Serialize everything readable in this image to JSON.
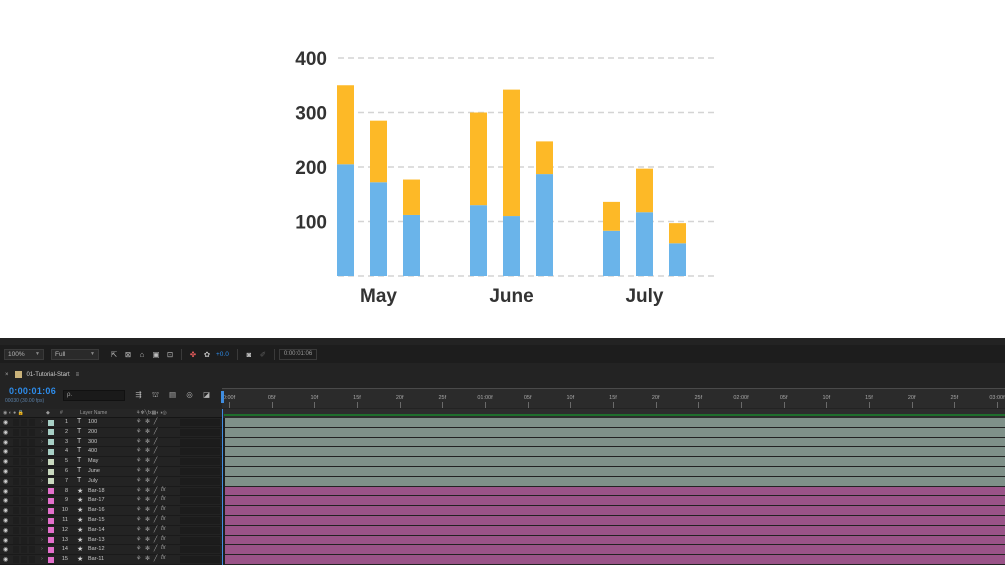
{
  "chart_data": {
    "type": "bar",
    "stacked": true,
    "groups": [
      "May",
      "June",
      "July"
    ],
    "bars": [
      {
        "group": "May",
        "bottom": 205,
        "top": 145
      },
      {
        "group": "May",
        "bottom": 172,
        "top": 113
      },
      {
        "group": "May",
        "bottom": 112,
        "top": 65
      },
      {
        "group": "June",
        "bottom": 130,
        "top": 170
      },
      {
        "group": "June",
        "bottom": 110,
        "top": 232
      },
      {
        "group": "June",
        "bottom": 187,
        "top": 60
      },
      {
        "group": "July",
        "bottom": 83,
        "top": 53
      },
      {
        "group": "July",
        "bottom": 117,
        "top": 80
      },
      {
        "group": "July",
        "bottom": 60,
        "top": 37
      }
    ],
    "yticks": [
      "100",
      "200",
      "300",
      "400"
    ],
    "ylim": [
      0,
      400
    ],
    "grid": "dashed horizontal",
    "colors": {
      "bottom": "#6ab4ea",
      "top": "#fdb927",
      "grid": "#d4d4d4"
    }
  },
  "viewer_bar": {
    "zoom": "100%",
    "resolution": "Full",
    "exposure": "+0.0",
    "timecode": "0:00:01:06"
  },
  "panel": {
    "tab_label": "01-Tutorial-Start"
  },
  "timeline": {
    "current_time": "0:00:01:06",
    "fps_label": "00030 (30.00 fps)",
    "search_placeholder": "ρ.",
    "columns": {
      "num": "#",
      "layer_name": "Layer Name"
    },
    "ruler_ticks": [
      "0:00f",
      "05f",
      "10f",
      "15f",
      "20f",
      "25f",
      "01:00f",
      "05f",
      "10f",
      "15f",
      "20f",
      "25f",
      "02:00f",
      "05f",
      "10f",
      "15f",
      "20f",
      "25f",
      "03:00f"
    ]
  },
  "layers": [
    {
      "num": "1",
      "name": "100",
      "type": "T",
      "color": "#a7cfc5",
      "fx": false
    },
    {
      "num": "2",
      "name": "200",
      "type": "T",
      "color": "#a7cfc5",
      "fx": false
    },
    {
      "num": "3",
      "name": "300",
      "type": "T",
      "color": "#a7cfc5",
      "fx": false
    },
    {
      "num": "4",
      "name": "400",
      "type": "T",
      "color": "#a7cfc5",
      "fx": false
    },
    {
      "num": "5",
      "name": "May",
      "type": "T",
      "color": "#c9d9bf",
      "fx": false
    },
    {
      "num": "6",
      "name": "June",
      "type": "T",
      "color": "#c9d9bf",
      "fx": false
    },
    {
      "num": "7",
      "name": "July",
      "type": "T",
      "color": "#c9d9bf",
      "fx": false
    },
    {
      "num": "8",
      "name": "Bar-18",
      "type": "★",
      "color": "#e36fcb",
      "fx": true
    },
    {
      "num": "9",
      "name": "Bar-17",
      "type": "★",
      "color": "#e36fcb",
      "fx": true
    },
    {
      "num": "10",
      "name": "Bar-16",
      "type": "★",
      "color": "#e36fcb",
      "fx": true
    },
    {
      "num": "11",
      "name": "Bar-15",
      "type": "★",
      "color": "#e36fcb",
      "fx": true
    },
    {
      "num": "12",
      "name": "Bar-14",
      "type": "★",
      "color": "#e36fcb",
      "fx": true
    },
    {
      "num": "13",
      "name": "Bar-13",
      "type": "★",
      "color": "#e36fcb",
      "fx": true
    },
    {
      "num": "14",
      "name": "Bar-12",
      "type": "★",
      "color": "#e36fcb",
      "fx": true
    },
    {
      "num": "15",
      "name": "Bar-11",
      "type": "★",
      "color": "#e36fcb",
      "fx": true
    }
  ],
  "track_colors": {
    "text": "#7f9189",
    "shape": "#9a5388"
  }
}
